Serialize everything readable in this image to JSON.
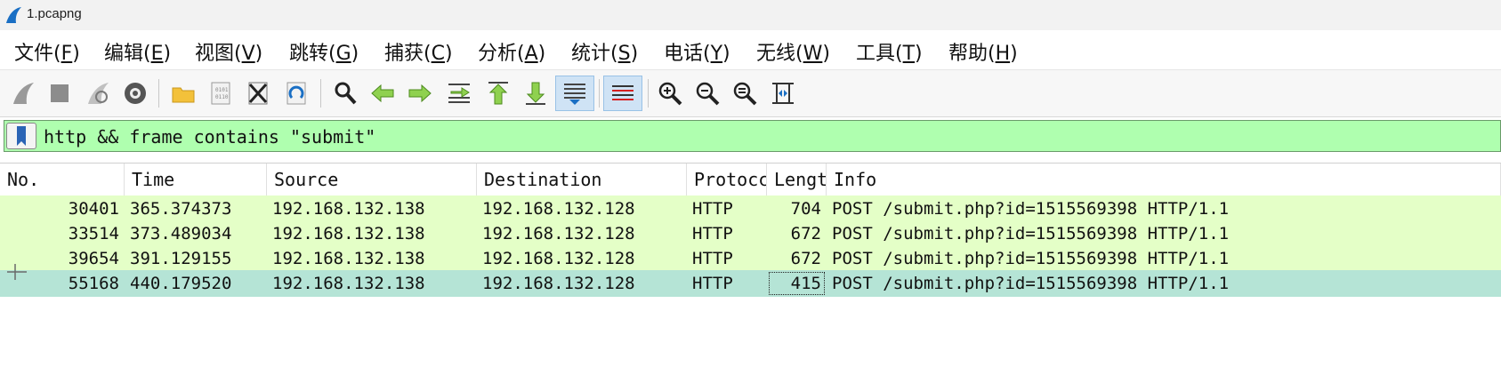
{
  "window": {
    "title": "1.pcapng",
    "logo": "wireshark-fin-icon"
  },
  "menu": [
    {
      "label": "文件(",
      "key": "F",
      "tail": ")"
    },
    {
      "label": "编辑(",
      "key": "E",
      "tail": ")"
    },
    {
      "label": "视图(",
      "key": "V",
      "tail": ")"
    },
    {
      "label": "跳转(",
      "key": "G",
      "tail": ")"
    },
    {
      "label": "捕获(",
      "key": "C",
      "tail": ")"
    },
    {
      "label": "分析(",
      "key": "A",
      "tail": ")"
    },
    {
      "label": "统计(",
      "key": "S",
      "tail": ")"
    },
    {
      "label": "电话(",
      "key": "Y",
      "tail": ")"
    },
    {
      "label": "无线(",
      "key": "W",
      "tail": ")"
    },
    {
      "label": "工具(",
      "key": "T",
      "tail": ")"
    },
    {
      "label": "帮助(",
      "key": "H",
      "tail": ")"
    }
  ],
  "toolbar": [
    "start-capture-icon",
    "stop-capture-icon",
    "restart-capture-icon",
    "capture-options-icon",
    "open-file-icon",
    "save-file-icon",
    "close-file-icon",
    "reload-file-icon",
    "find-packet-icon",
    "go-back-icon",
    "go-forward-icon",
    "go-to-packet-icon",
    "first-packet-icon",
    "last-packet-icon",
    "autoscroll-icon",
    "colorize-icon",
    "zoom-in-icon",
    "zoom-out-icon",
    "zoom-normal-icon",
    "resize-columns-icon"
  ],
  "filter": {
    "value": "http && frame contains \"submit\"",
    "bg_color": "#afffaf"
  },
  "columns": [
    "No.",
    "Time",
    "Source",
    "Destination",
    "Protocc",
    "Lengt",
    "Info"
  ],
  "packets": [
    {
      "no": "30401",
      "time": "365.374373",
      "source": "192.168.132.138",
      "destination": "192.168.132.128",
      "protocol": "HTTP",
      "length": "704",
      "info": "POST /submit.php?id=1515569398 HTTP/1.1"
    },
    {
      "no": "33514",
      "time": "373.489034",
      "source": "192.168.132.138",
      "destination": "192.168.132.128",
      "protocol": "HTTP",
      "length": "672",
      "info": "POST /submit.php?id=1515569398 HTTP/1.1"
    },
    {
      "no": "39654",
      "time": "391.129155",
      "source": "192.168.132.138",
      "destination": "192.168.132.128",
      "protocol": "HTTP",
      "length": "672",
      "info": "POST /submit.php?id=1515569398 HTTP/1.1"
    },
    {
      "no": "55168",
      "time": "440.179520",
      "source": "192.168.132.138",
      "destination": "192.168.132.128",
      "protocol": "HTTP",
      "length": "415",
      "info": "POST /submit.php?id=1515569398 HTTP/1.1"
    }
  ],
  "colors": {
    "row_bg": "#e4ffc7",
    "selected_row_bg": "#b5e4d6",
    "accent": "#1a6fc4"
  }
}
